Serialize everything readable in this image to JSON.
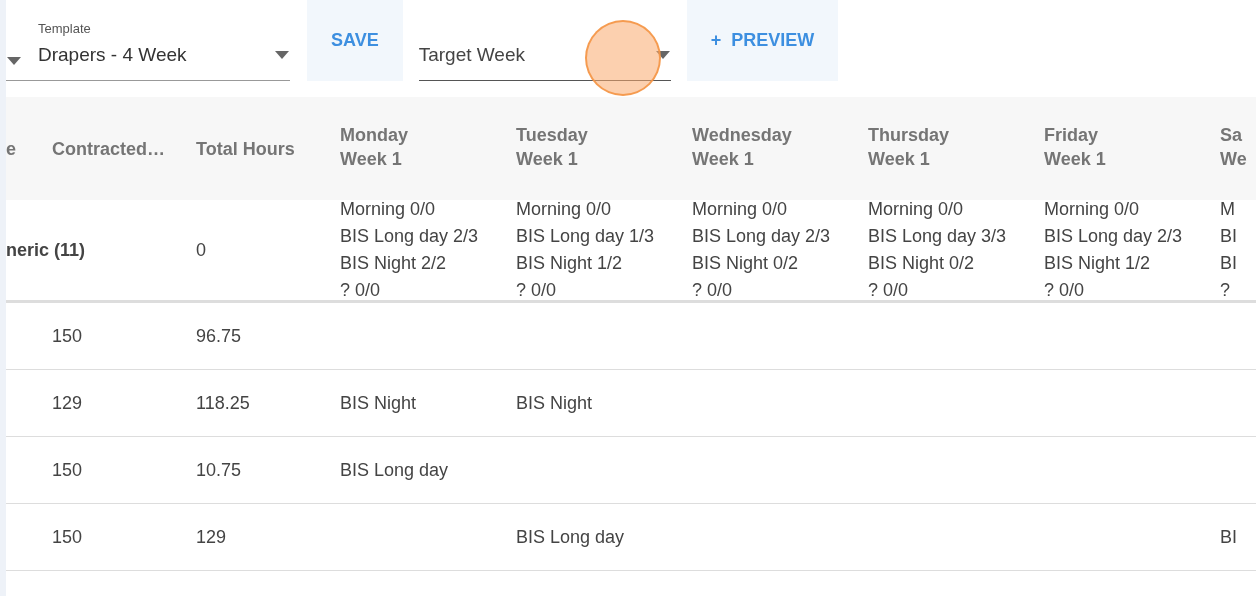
{
  "toolbar": {
    "template": {
      "label": "Template",
      "value": "Drapers - 4 Week"
    },
    "save": "SAVE",
    "target_week": {
      "placeholder": "Target Week"
    },
    "preview": {
      "icon": "+",
      "label": "PREVIEW"
    }
  },
  "table": {
    "columns": [
      [
        "e"
      ],
      [
        "Contracted…"
      ],
      [
        "Total Hours"
      ],
      [
        "Monday",
        "Week 1"
      ],
      [
        "Tuesday",
        "Week 1"
      ],
      [
        "Wednesday",
        "Week 1"
      ],
      [
        "Thursday",
        "Week 1"
      ],
      [
        "Friday",
        "Week 1"
      ],
      [
        "Sa",
        "We"
      ]
    ],
    "group": {
      "label": "neric (11)",
      "total": "0",
      "days": [
        [
          "Morning 0/0",
          "BIS Long day 2/3",
          "BIS Night 2/2",
          "? 0/0"
        ],
        [
          "Morning 0/0",
          "BIS Long day 1/3",
          "BIS Night 1/2",
          "? 0/0"
        ],
        [
          "Morning 0/0",
          "BIS Long day 2/3",
          "BIS Night 0/2",
          "? 0/0"
        ],
        [
          "Morning 0/0",
          "BIS Long day 3/3",
          "BIS Night 0/2",
          "? 0/0"
        ],
        [
          "Morning 0/0",
          "BIS Long day 2/3",
          "BIS Night 1/2",
          "? 0/0"
        ],
        [
          "M",
          "BI",
          "BI",
          "?"
        ]
      ]
    },
    "rows": [
      {
        "contracted": "150",
        "total": "96.75",
        "days": {}
      },
      {
        "contracted": "129",
        "total": "118.25",
        "days": {
          "monday": "BIS Night",
          "tuesday": "BIS Night"
        }
      },
      {
        "contracted": "150",
        "total": "10.75",
        "days": {
          "monday": "BIS Long day"
        }
      },
      {
        "contracted": "150",
        "total": "129",
        "days": {
          "tuesday": "BIS Long day",
          "saturday": "BI"
        }
      }
    ]
  }
}
